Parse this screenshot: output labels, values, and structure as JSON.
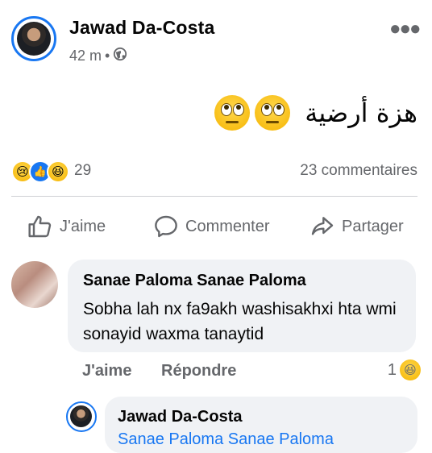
{
  "post": {
    "author": "Jawad Da-Costa",
    "time": "42 m",
    "separator": "•",
    "text": "هزة أرضية",
    "reaction_count": "29",
    "comment_count": "23 commentaires"
  },
  "actions": {
    "like": "J'aime",
    "comment": "Commenter",
    "share": "Partager"
  },
  "comment": {
    "author": "Sanae Paloma Sanae Paloma",
    "text": "Sobha lah nx fa9akh washisakhxi hta wmi sonayid waxma tanaytid",
    "like": "J'aime",
    "reply": "Répondre",
    "reaction_count": "1"
  },
  "reply": {
    "author": "Jawad Da-Costa",
    "mention": "Sanae Paloma Sanae Paloma"
  },
  "icons": {
    "privacy": "globe-icon",
    "more": "more-options-icon",
    "like": "thumbs-up-icon",
    "comment": "speech-bubble-icon",
    "share": "share-arrow-icon"
  },
  "colors": {
    "accent": "#1877f2",
    "secondary_text": "#65676b",
    "bubble": "#f0f2f5"
  }
}
